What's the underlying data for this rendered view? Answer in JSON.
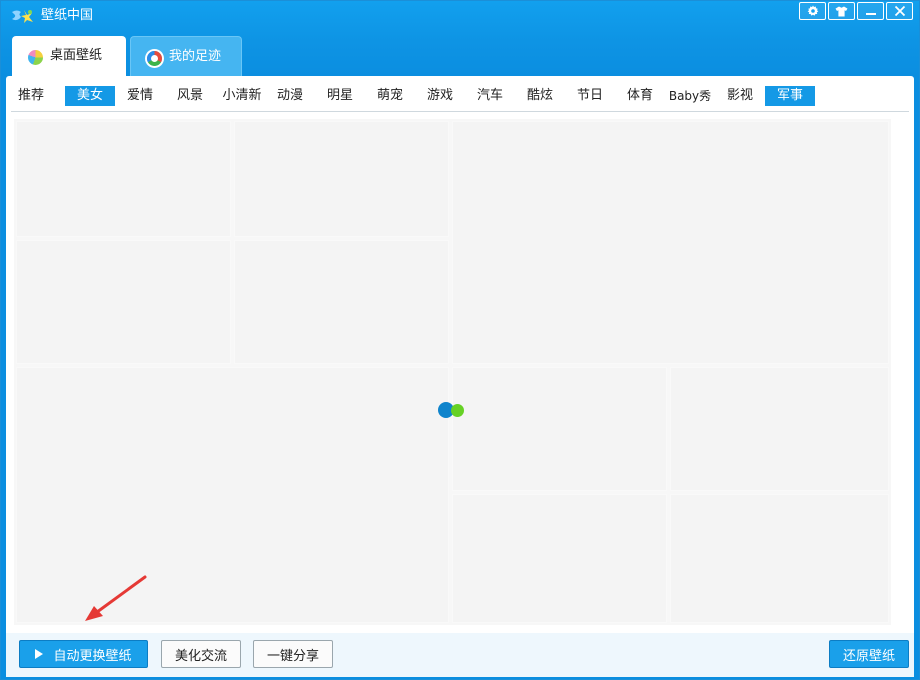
{
  "app": {
    "title": "壁纸中国"
  },
  "window_controls": [
    "settings",
    "skin",
    "minimize",
    "close"
  ],
  "tabs": [
    {
      "label": "桌面壁纸",
      "active": true,
      "icon": "desktop-wallpaper-icon"
    },
    {
      "label": "我的足迹",
      "active": false,
      "icon": "footprint-icon"
    }
  ],
  "categories": [
    {
      "label": "推荐",
      "selected": false
    },
    {
      "label": "美女",
      "selected": true
    },
    {
      "label": "爱情",
      "selected": false
    },
    {
      "label": "风景",
      "selected": false
    },
    {
      "label": "小清新",
      "selected": false
    },
    {
      "label": "动漫",
      "selected": false
    },
    {
      "label": "明星",
      "selected": false
    },
    {
      "label": "萌宠",
      "selected": false
    },
    {
      "label": "游戏",
      "selected": false
    },
    {
      "label": "汽车",
      "selected": false
    },
    {
      "label": "酷炫",
      "selected": false
    },
    {
      "label": "节日",
      "selected": false
    },
    {
      "label": "体育",
      "selected": false
    },
    {
      "label": "Baby秀",
      "selected": false
    },
    {
      "label": "影视",
      "selected": false
    },
    {
      "label": "军事",
      "selected": false,
      "highlighted": true
    }
  ],
  "toolbar": {
    "auto_change_label": "自动更换壁纸",
    "beautify_label": "美化交流",
    "share_label": "一键分享",
    "restore_label": "还原壁纸"
  },
  "colors": {
    "accent": "#1499e6",
    "title_bar": "#12a0ee",
    "loader_blue": "#0f84cc",
    "loader_green": "#66d125",
    "annotation": "#e53935"
  }
}
